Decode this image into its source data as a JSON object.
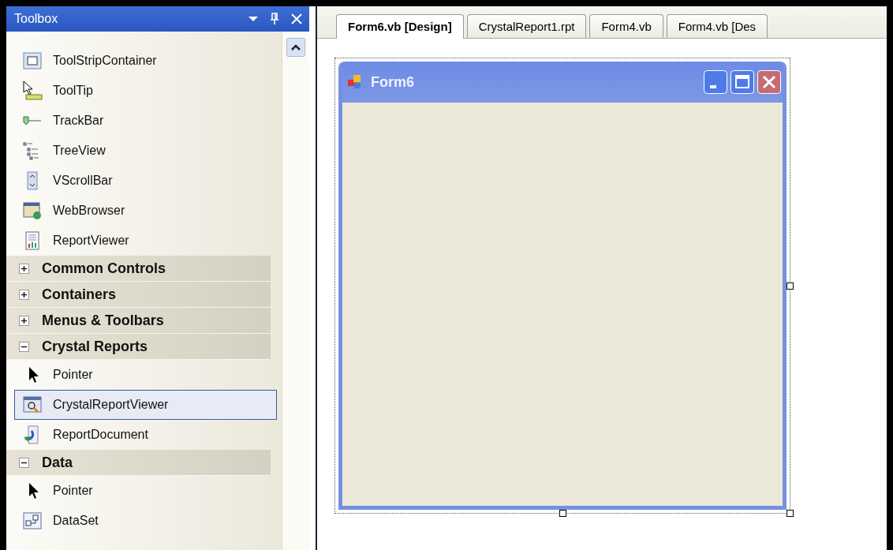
{
  "toolbox": {
    "title": "Toolbox",
    "entries": [
      {
        "kind": "item",
        "label": "ToolStripContainer",
        "selected": false
      },
      {
        "kind": "item",
        "label": "ToolTip",
        "selected": false
      },
      {
        "kind": "item",
        "label": "TrackBar",
        "selected": false
      },
      {
        "kind": "item",
        "label": "TreeView",
        "selected": false
      },
      {
        "kind": "item",
        "label": "VScrollBar",
        "selected": false
      },
      {
        "kind": "item",
        "label": "WebBrowser",
        "selected": false
      },
      {
        "kind": "item",
        "label": "ReportViewer",
        "selected": false
      },
      {
        "kind": "category",
        "label": "Common Controls",
        "expanded": false
      },
      {
        "kind": "category",
        "label": "Containers",
        "expanded": false
      },
      {
        "kind": "category",
        "label": "Menus & Toolbars",
        "expanded": false
      },
      {
        "kind": "category",
        "label": "Crystal Reports",
        "expanded": true
      },
      {
        "kind": "item",
        "label": "Pointer",
        "selected": false
      },
      {
        "kind": "item",
        "label": "CrystalReportViewer",
        "selected": true
      },
      {
        "kind": "item",
        "label": "ReportDocument",
        "selected": false
      },
      {
        "kind": "category",
        "label": "Data",
        "expanded": true
      },
      {
        "kind": "item",
        "label": "Pointer",
        "selected": false
      },
      {
        "kind": "item",
        "label": "DataSet",
        "selected": false
      }
    ]
  },
  "tabs": [
    {
      "label": "Form6.vb [Design]",
      "selected": true
    },
    {
      "label": "CrystalReport1.rpt",
      "selected": false
    },
    {
      "label": "Form4.vb",
      "selected": false
    },
    {
      "label": "Form4.vb [Des",
      "selected": false
    }
  ],
  "form": {
    "title": "Form6"
  }
}
